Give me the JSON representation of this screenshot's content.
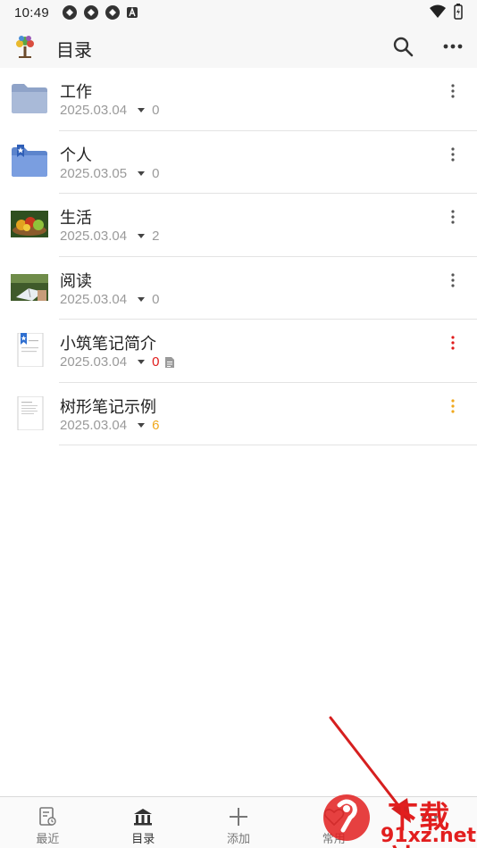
{
  "status_bar": {
    "time": "10:49"
  },
  "app_bar": {
    "title": "目录"
  },
  "items": [
    {
      "title": "工作",
      "date": "2025.03.04",
      "count": "0",
      "icon": "folder-icon",
      "count_color": "gray",
      "has_doc": false
    },
    {
      "title": "个人",
      "date": "2025.03.05",
      "count": "0",
      "icon": "bookmark-folder-icon",
      "count_color": "gray",
      "has_doc": false
    },
    {
      "title": "生活",
      "date": "2025.03.04",
      "count": "2",
      "icon": "fruit-photo-icon",
      "count_color": "gray",
      "has_doc": false
    },
    {
      "title": "阅读",
      "date": "2025.03.04",
      "count": "0",
      "icon": "reading-photo-icon",
      "count_color": "gray",
      "has_doc": false
    },
    {
      "title": "小筑笔记简介",
      "date": "2025.03.04",
      "count": "0",
      "icon": "bookmark-note-icon",
      "count_color": "red",
      "has_doc": true
    },
    {
      "title": "树形笔记示例",
      "date": "2025.03.04",
      "count": "6",
      "icon": "note-page-icon",
      "count_color": "orange",
      "has_doc": false
    }
  ],
  "bottom_nav": [
    {
      "label": "最近",
      "icon": "recent-note-icon",
      "active": false
    },
    {
      "label": "目录",
      "icon": "library-icon",
      "active": true
    },
    {
      "label": "添加",
      "icon": "plus-icon",
      "active": false
    },
    {
      "label": "常用",
      "icon": "heart-icon",
      "active": false
    },
    {
      "label": "",
      "icon": "more-icon",
      "active": false
    }
  ],
  "watermark": {
    "line1": "下载站",
    "line2": "91xz.net"
  },
  "colors": {
    "accent_red": "#e01b1b",
    "accent_orange": "#f0a81c",
    "folder_blue": "#6f95d6",
    "watermark_red": "#e21e1e"
  }
}
